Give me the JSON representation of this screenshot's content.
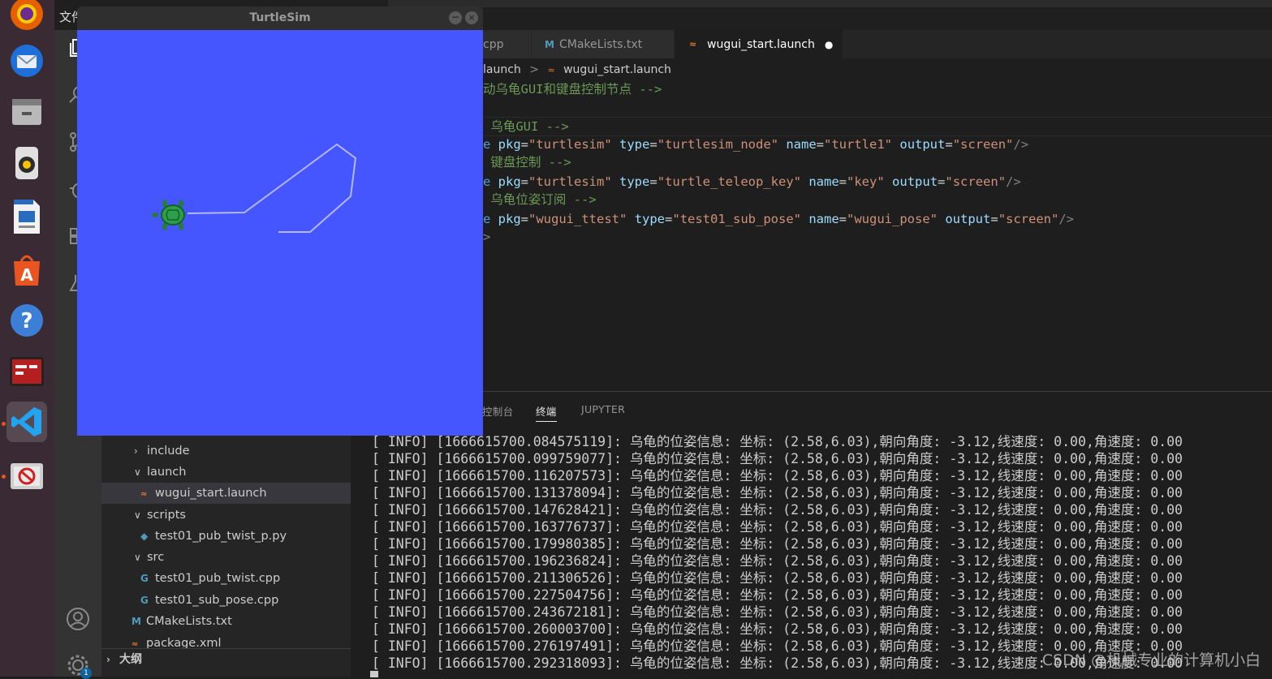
{
  "desktop": {
    "menu_partial": "文件",
    "dock": [
      "firefox-icon",
      "thunderbird-icon",
      "files-icon",
      "rhythmbox-icon",
      "writer-icon",
      "software-center-icon",
      "help-icon",
      "terminal-icon",
      "vscode-icon",
      "disabled-app-icon"
    ]
  },
  "turtlesim": {
    "title": "TurtleSim",
    "background_color": "#4556ff",
    "path_color": "#b3b8ff"
  },
  "editor": {
    "tabs": [
      {
        "label": "cpp",
        "icon": "cpp-file-icon"
      },
      {
        "label": "CMakeLists.txt",
        "icon": "cmake-file-icon"
      },
      {
        "label": "wugui_start.launch",
        "icon": "launch-file-icon",
        "modified_dot": "●"
      }
    ],
    "breadcrumb": {
      "part1": "launch",
      "separator": ">",
      "file": "wugui_start.launch"
    },
    "code": {
      "l1_comment": "动乌龟GUI和键盘控制节点 -->",
      "l3_comment": " 乌龟GUI -->",
      "l4": {
        "prefix": "e ",
        "pkg_attr": "pkg",
        "pkg_val": "\"turtlesim\"",
        "type_attr": "type",
        "type_val": "\"turtlesim_node\"",
        "name_attr": "name",
        "name_val": "\"turtle1\"",
        "out_attr": "output",
        "out_val": "\"screen\"",
        "close": "/>"
      },
      "l5_comment": " 键盘控制 -->",
      "l6": {
        "prefix": "e ",
        "pkg_attr": "pkg",
        "pkg_val": "\"turtlesim\"",
        "type_attr": "type",
        "type_val": "\"turtle_teleop_key\"",
        "name_attr": "name",
        "name_val": "\"key\"",
        "out_attr": "output",
        "out_val": "\"screen\"",
        "close": "/>"
      },
      "l7_comment": " 乌龟位姿订阅 -->",
      "l8": {
        "prefix": "e ",
        "pkg_attr": "pkg",
        "pkg_val": "\"wugui_ttest\"",
        "type_attr": "type",
        "type_val": "\"test01_sub_pose\"",
        "name_attr": "name",
        "name_val": "\"wugui_pose\"",
        "out_attr": "output",
        "out_val": "\"screen\"",
        "close": "/>"
      },
      "l9_close": ">"
    }
  },
  "panel": {
    "tabs": [
      "控制台",
      "终端",
      "JUPYTER"
    ],
    "active_tab": "终端",
    "log_prefix": "[ INFO] ",
    "log_message": ": 乌龟的位姿信息: 坐标: (2.58,6.03),朝向角度: -3.12,线速度: 0.00,角速度: 0.00",
    "timestamps": [
      "[1666615700.084575119]",
      "[1666615700.099759077]",
      "[1666615700.116207573]",
      "[1666615700.131378094]",
      "[1666615700.147628421]",
      "[1666615700.163776737]",
      "[1666615700.179980385]",
      "[1666615700.196236824]",
      "[1666615700.211306526]",
      "[1666615700.227504756]",
      "[1666615700.243672181]",
      "[1666615700.260003700]",
      "[1666615700.276197491]",
      "[1666615700.292318093]"
    ]
  },
  "explorer": {
    "items": [
      {
        "label": "include",
        "kind": "folder-collapsed"
      },
      {
        "label": "launch",
        "kind": "folder-open"
      },
      {
        "label": "wugui_start.launch",
        "kind": "launch-file",
        "selected": true
      },
      {
        "label": "scripts",
        "kind": "folder-open"
      },
      {
        "label": "test01_pub_twist_p.py",
        "kind": "python-file"
      },
      {
        "label": "src",
        "kind": "folder-open"
      },
      {
        "label": "test01_pub_twist.cpp",
        "kind": "cpp-file"
      },
      {
        "label": "test01_sub_pose.cpp",
        "kind": "cpp-file"
      },
      {
        "label": "CMakeLists.txt",
        "kind": "cmake-file"
      },
      {
        "label": "package.xml",
        "kind": "xml-file"
      }
    ],
    "outline_label": "大纲"
  },
  "watermark": "CSDN @机械专业的计算机小白"
}
